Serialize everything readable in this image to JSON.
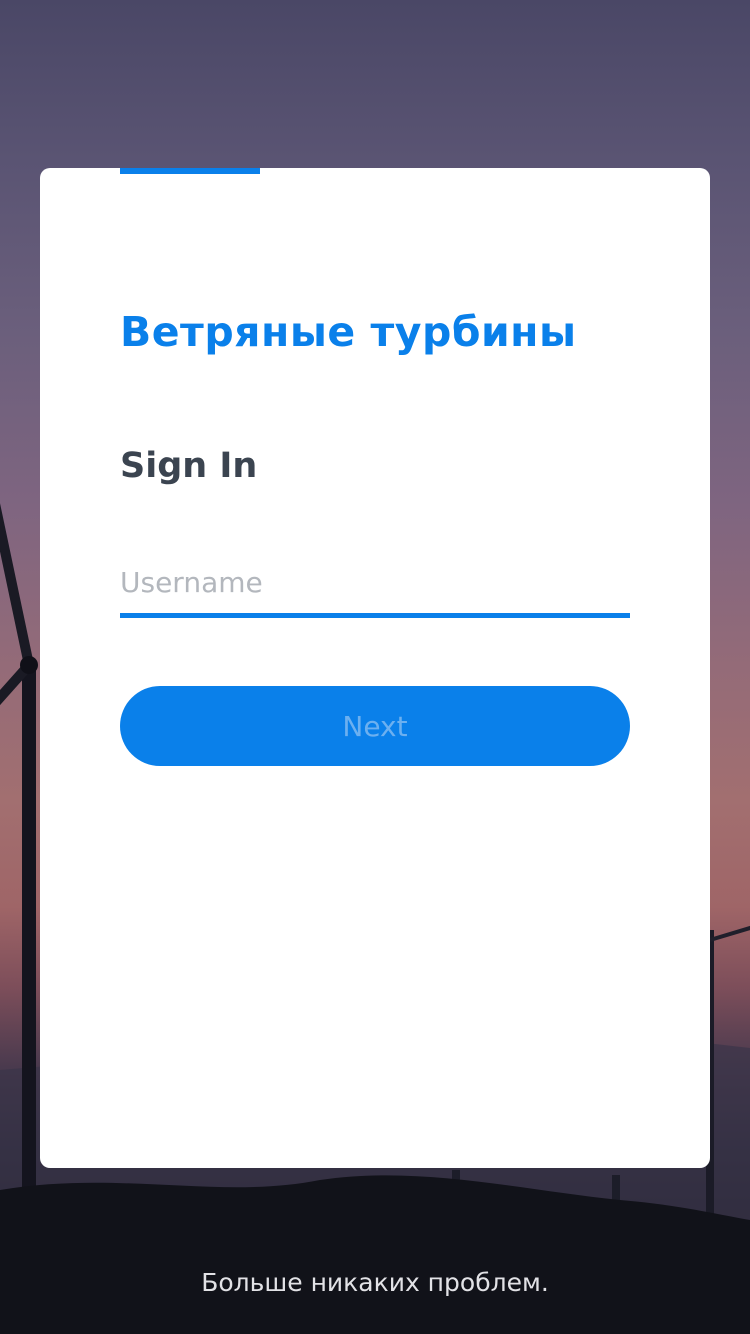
{
  "app": {
    "brand_title": "Ветряные турбины",
    "tagline": "Больше никаких проблем."
  },
  "login": {
    "heading": "Sign In",
    "username_placeholder": "Username",
    "username_value": "",
    "next_label": "Next"
  },
  "colors": {
    "accent": "#0a80ea",
    "heading_text": "#3b4450",
    "card_background": "#ffffff"
  },
  "background": {
    "scene": "wind-turbines-at-dusk"
  }
}
